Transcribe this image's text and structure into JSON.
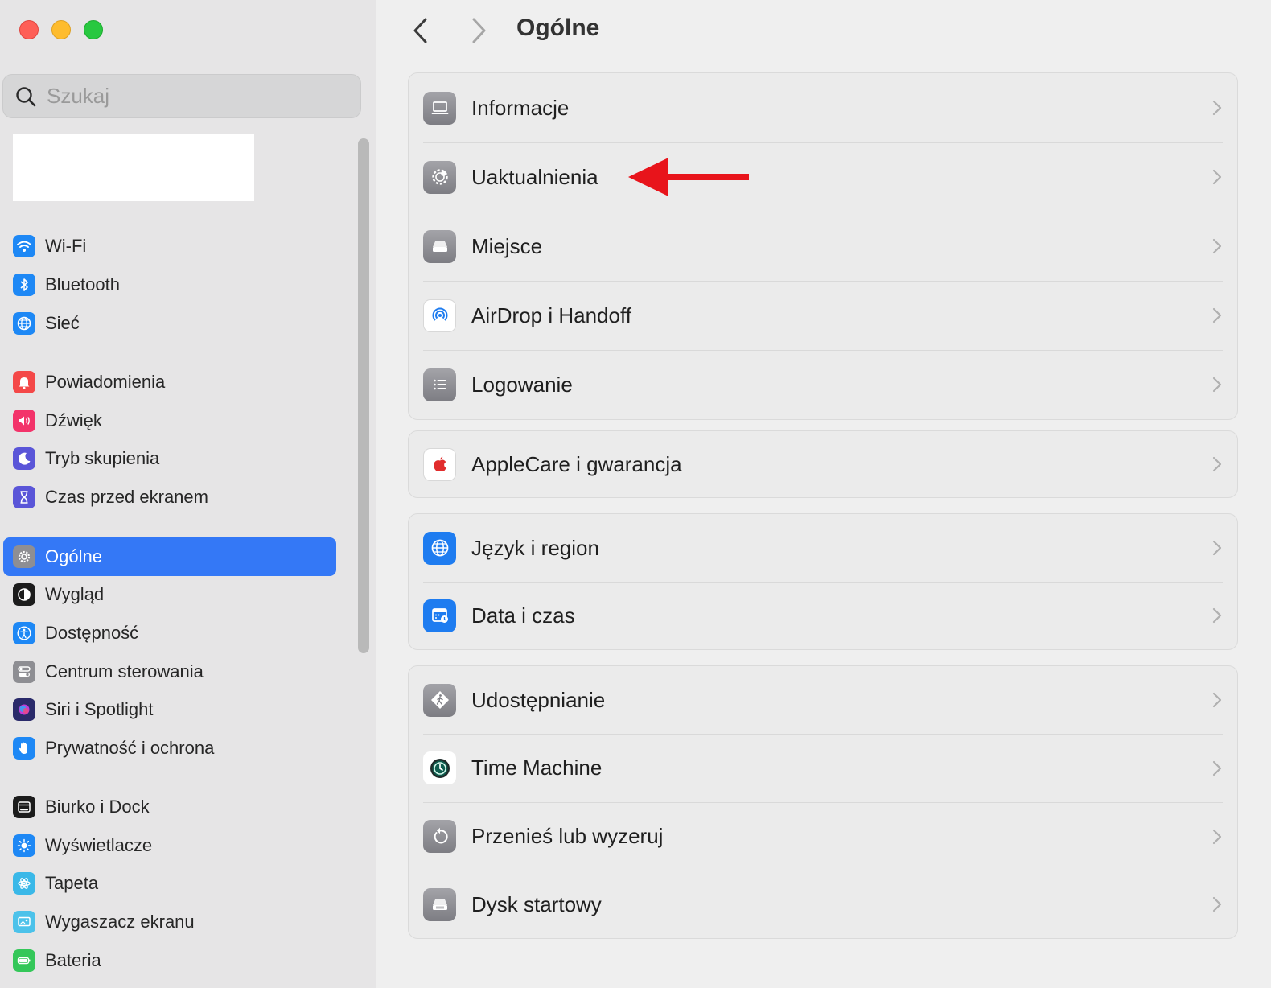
{
  "search": {
    "placeholder": "Szukaj"
  },
  "sidebar": {
    "items": [
      {
        "label": "Wi-Fi",
        "icon": "wifi-icon",
        "color": "#1e88f5"
      },
      {
        "label": "Bluetooth",
        "icon": "bluetooth-icon",
        "color": "#1e88f5"
      },
      {
        "label": "Sieć",
        "icon": "globe-icon",
        "color": "#1e88f5"
      },
      {
        "label": "Powiadomienia",
        "icon": "bell-icon",
        "color": "#f44848"
      },
      {
        "label": "Dźwięk",
        "icon": "speaker-icon",
        "color": "#f3336a"
      },
      {
        "label": "Tryb skupienia",
        "icon": "moon-icon",
        "color": "#5a55d8"
      },
      {
        "label": "Czas przed ekranem",
        "icon": "hourglass-icon",
        "color": "#5a55d8"
      },
      {
        "label": "Ogólne",
        "icon": "gear-icon",
        "color": "#8e8e93",
        "active": true
      },
      {
        "label": "Wygląd",
        "icon": "appearance-icon",
        "color": "#1c1c1c"
      },
      {
        "label": "Dostępność",
        "icon": "accessibility-icon",
        "color": "#1e88f5"
      },
      {
        "label": "Centrum sterowania",
        "icon": "toggles-icon",
        "color": "#8e8e93"
      },
      {
        "label": "Siri i Spotlight",
        "icon": "siri-icon",
        "color": "#2a2a6a"
      },
      {
        "label": "Prywatność i ochrona",
        "icon": "hand-icon",
        "color": "#1e88f5"
      },
      {
        "label": "Biurko i Dock",
        "icon": "dock-icon",
        "color": "#1c1c1c"
      },
      {
        "label": "Wyświetlacze",
        "icon": "sun-icon",
        "color": "#1e88f5"
      },
      {
        "label": "Tapeta",
        "icon": "flower-icon",
        "color": "#3ab8e8"
      },
      {
        "label": "Wygaszacz ekranu",
        "icon": "screensaver-icon",
        "color": "#4cc2ea"
      },
      {
        "label": "Bateria",
        "icon": "battery-icon",
        "color": "#34c759"
      }
    ]
  },
  "main": {
    "title": "Ogólne",
    "groups": [
      [
        {
          "label": "Informacje",
          "icon": "laptop-icon",
          "color": "#8e8e93"
        },
        {
          "label": "Uaktualnienia",
          "icon": "software-update-gear-icon",
          "color": "#8e8e93"
        },
        {
          "label": "Miejsce",
          "icon": "storage-drive-icon",
          "color": "#8e8e93"
        },
        {
          "label": "AirDrop i Handoff",
          "icon": "airdrop-icon",
          "color": "#ffffff"
        },
        {
          "label": "Logowanie",
          "icon": "list-icon",
          "color": "#8e8e93"
        }
      ],
      [
        {
          "label": "AppleCare i gwarancja",
          "icon": "apple-logo-icon",
          "color": "#ffffff"
        }
      ],
      [
        {
          "label": "Język i region",
          "icon": "globe-icon",
          "color": "#1e7cf0"
        },
        {
          "label": "Data i czas",
          "icon": "calendar-clock-icon",
          "color": "#1e7cf0"
        }
      ],
      [
        {
          "label": "Udostępnianie",
          "icon": "sharing-icon",
          "color": "#8e8e93"
        },
        {
          "label": "Time Machine",
          "icon": "time-machine-icon",
          "color": "#ffffff"
        },
        {
          "label": "Przenieś lub wyzeruj",
          "icon": "reset-icon",
          "color": "#8e8e93"
        },
        {
          "label": "Dysk startowy",
          "icon": "startup-disk-icon",
          "color": "#8e8e93"
        }
      ]
    ]
  },
  "annotation": {
    "arrow_color": "#e8141b"
  }
}
